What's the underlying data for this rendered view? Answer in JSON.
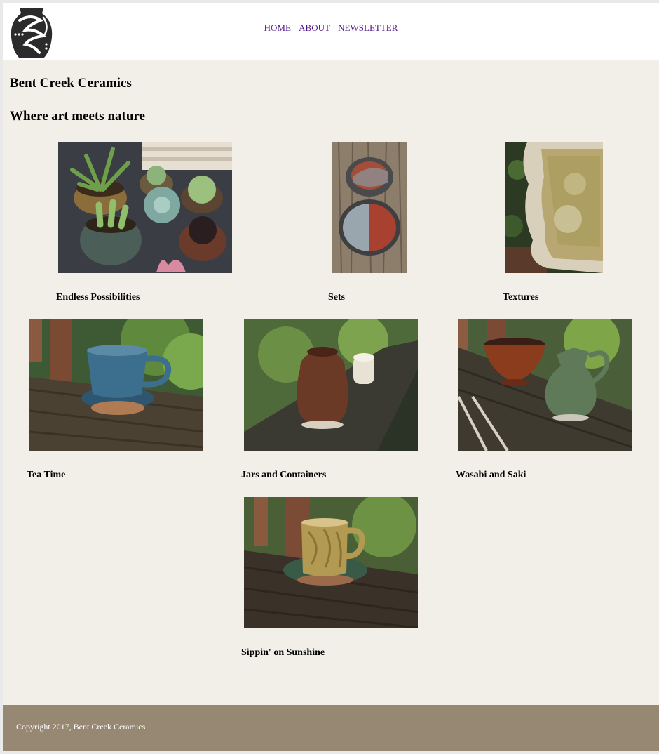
{
  "header": {
    "logo_icon": "pottery-vase-logo-icon",
    "nav": [
      {
        "label": "HOME"
      },
      {
        "label": "ABOUT"
      },
      {
        "label": "NEWSLETTER"
      }
    ]
  },
  "main": {
    "site_title": "Bent Creek Ceramics",
    "tagline": "Where art meets nature",
    "gallery": [
      {
        "caption": "Endless Possibilities",
        "image": "succulent-planters-photo"
      },
      {
        "caption": "Sets",
        "image": "bowl-set-photo"
      },
      {
        "caption": "Textures",
        "image": "glazed-platter-photo"
      },
      {
        "caption": "Tea Time",
        "image": "blue-teacup-photo"
      },
      {
        "caption": "Jars and Containers",
        "image": "brown-jar-photo"
      },
      {
        "caption": "Wasabi and Saki",
        "image": "bowl-and-pitcher-photo"
      },
      {
        "caption": "Sippin' on Sunshine",
        "image": "yellow-mug-photo"
      }
    ]
  },
  "footer": {
    "copyright": "Copyright 2017, Bent Creek Ceramics"
  },
  "colors": {
    "page_background": "#f1efe8",
    "header_background": "#ffffff",
    "footer_background": "#978873",
    "link_color": "#551a8b"
  }
}
